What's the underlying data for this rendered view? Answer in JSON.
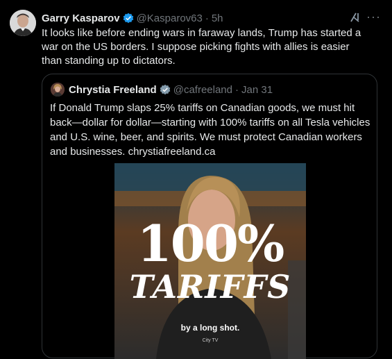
{
  "tweet": {
    "author_name": "Garry Kasparov",
    "handle": "@Kasparov63",
    "separator": "·",
    "time": "5h",
    "text": "It looks like before ending wars in faraway lands, Trump has started a war on the US borders. I suppose picking fights with allies is easier than standing up to dictators.",
    "verified_color": "#1d9bf0"
  },
  "quoted": {
    "author_name": "Chrystia Freeland",
    "handle": "@cafreeland",
    "separator": "·",
    "time": "Jan 31",
    "text": "If Donald Trump slaps 25% tariffs on Canadian goods, we must hit back—dollar for dollar—starting with 100% tariffs on all Tesla vehicles and U.S. wine, beer, and spirits. We must protect Canadian workers and businesses. chrystiafreeland.ca",
    "verified_color": "#829aab"
  },
  "media": {
    "headline_number": "100%",
    "headline_word": "TARIFFS",
    "caption": "by a long shot.",
    "source": "City TV"
  },
  "icons": {
    "grok": "grok-icon",
    "more": "more-icon"
  }
}
